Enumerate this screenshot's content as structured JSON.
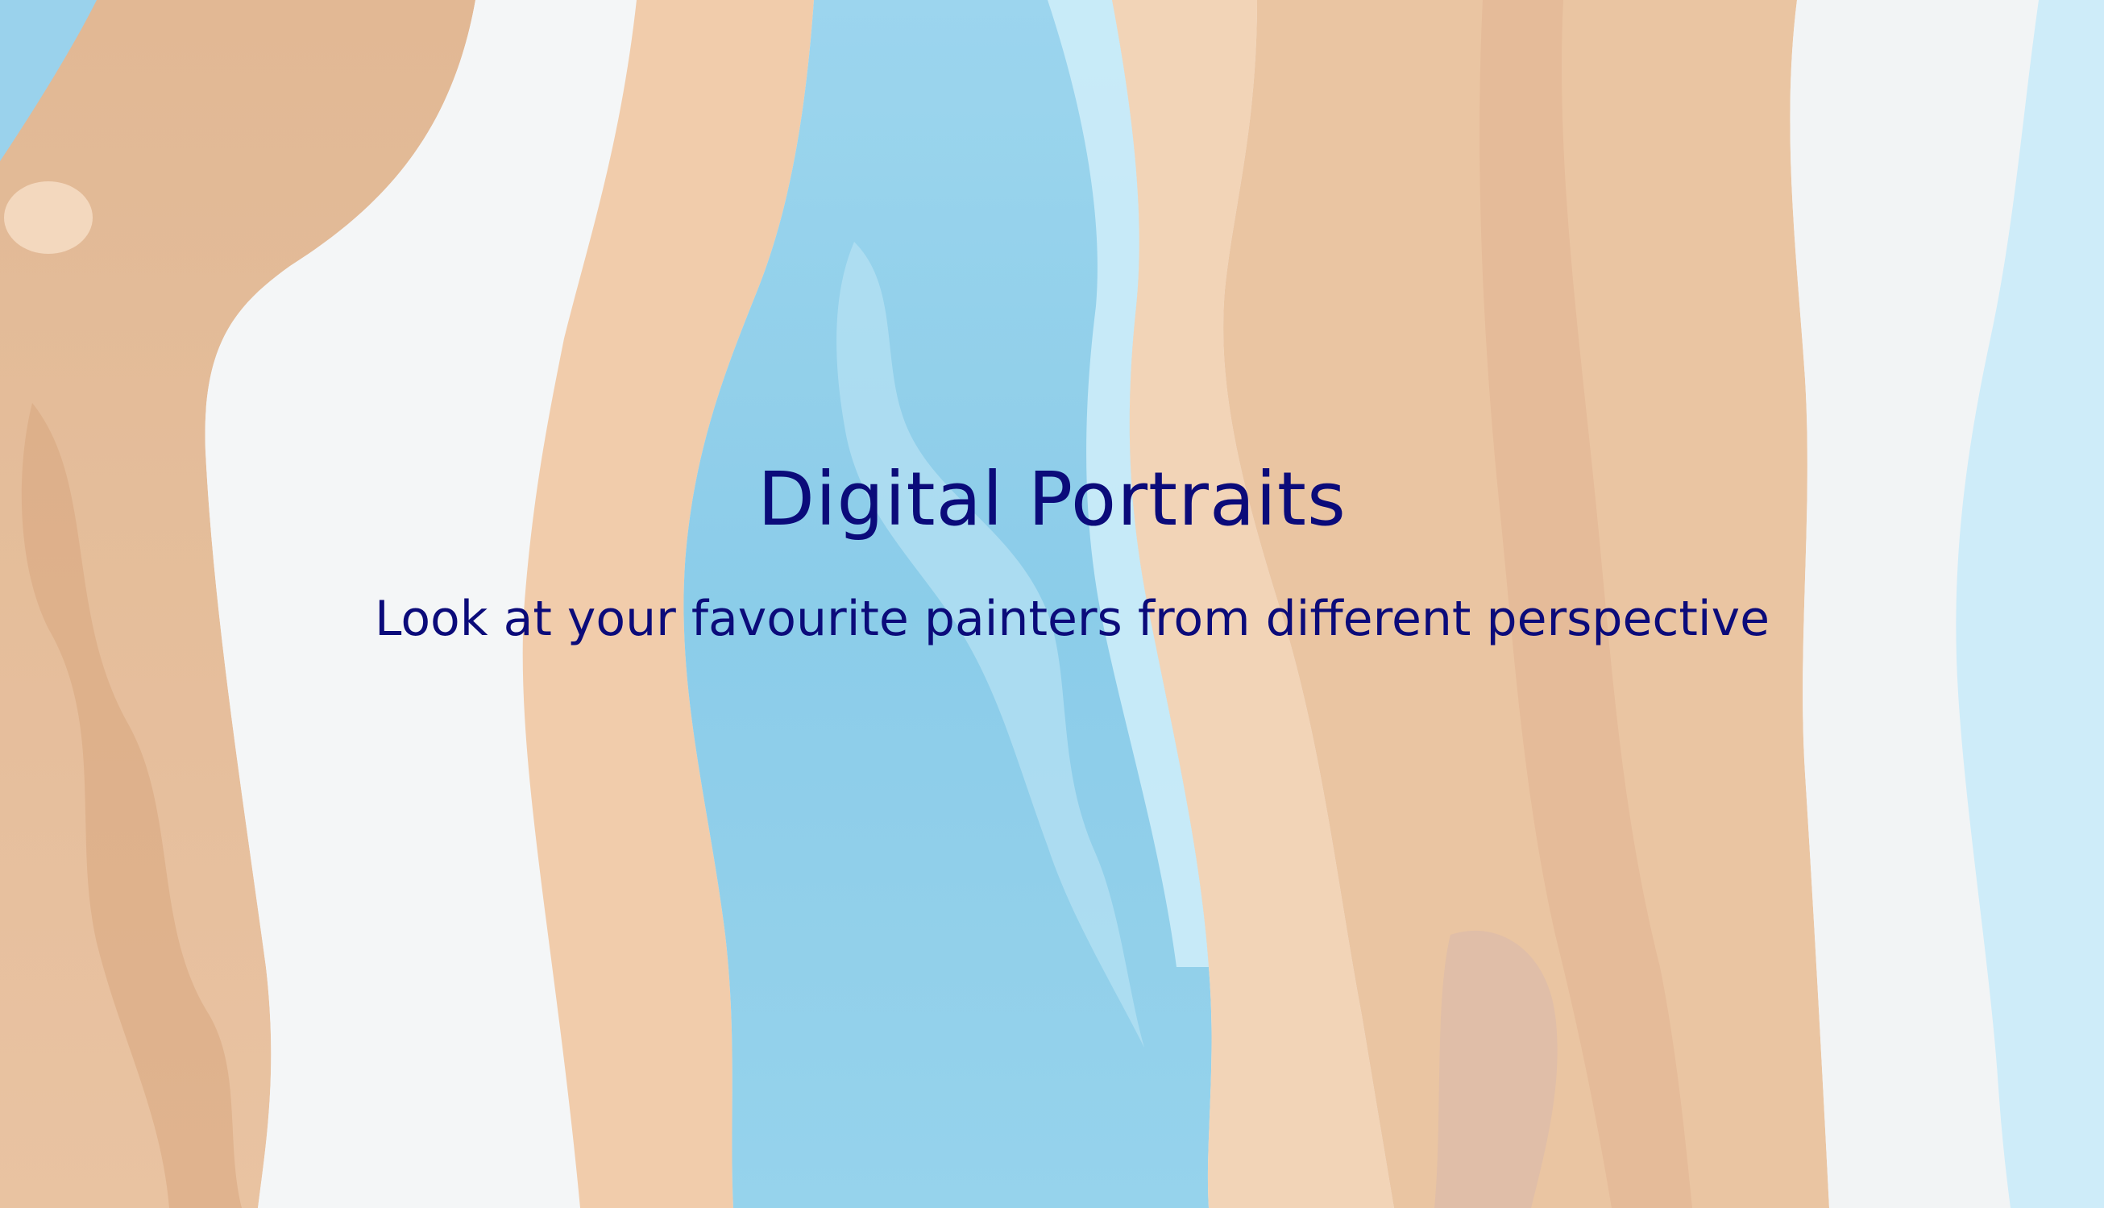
{
  "hero": {
    "title": "Digital Portraits",
    "subtitle": "Look at your favourite painters from different perspective",
    "background": "abstract-fluid-art-image"
  },
  "colors": {
    "text": "#0b0b7a",
    "tan": "#efc9a8",
    "brown": "#e2b18a",
    "deep_brown": "#d7a37b",
    "sky": "#8fd0ec",
    "sky_deep": "#7cc6e6",
    "pale": "#f3f5f6",
    "pale_blue": "#c9ebf9"
  }
}
